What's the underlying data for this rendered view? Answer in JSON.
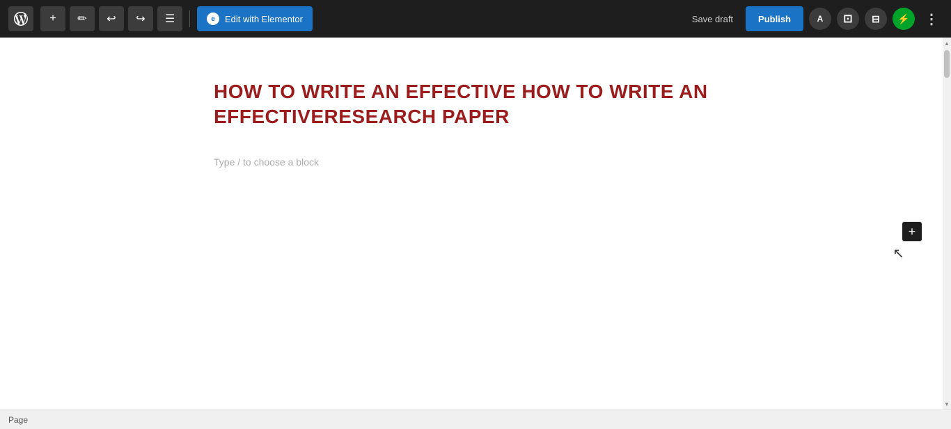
{
  "toolbar": {
    "add_label": "+",
    "edit_elementor_label": "Edit with Elementor",
    "save_draft_label": "Save draft",
    "publish_label": "Publish",
    "elementor_icon": "e",
    "wp_icon": "W",
    "autosave_icon": "A",
    "panel_icon": "⊟",
    "bolt_icon": "⚡",
    "more_icon": "⋮"
  },
  "editor": {
    "post_title": "HOW TO WRITE AN EFFECTIVE HOW TO WRITE AN EFFECTIVERESEARCH PAPER",
    "block_placeholder": "Type / to choose a block",
    "add_block_label": "+"
  },
  "status_bar": {
    "page_label": "Page"
  },
  "colors": {
    "toolbar_bg": "#1e1e1e",
    "primary_blue": "#1a73c4",
    "title_color": "#9b1c1c",
    "green_accent": "#00a32a"
  }
}
